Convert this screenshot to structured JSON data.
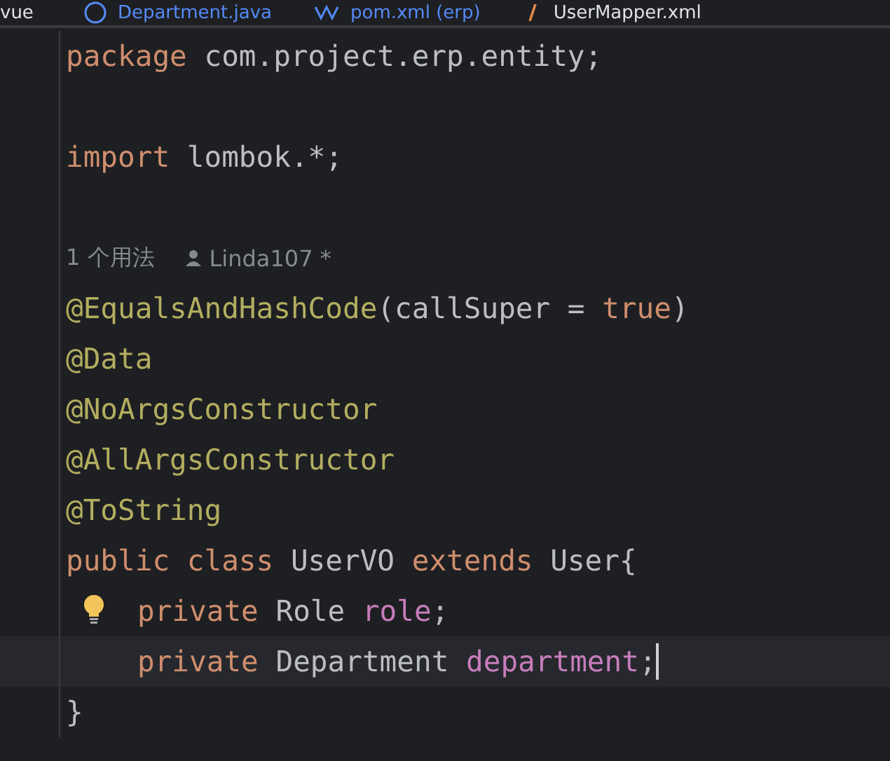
{
  "tabs": [
    {
      "label": "vue",
      "kind": "plain",
      "modified": false
    },
    {
      "label": "Department.java",
      "kind": "class",
      "modified": true
    },
    {
      "label": "pom.xml (erp)",
      "kind": "maven",
      "modified": true
    },
    {
      "label": "UserMapper.xml",
      "kind": "xml",
      "modified": false
    }
  ],
  "lines": [
    {
      "kind": "code",
      "indent": false,
      "current": false,
      "bulb": false,
      "tokens": [
        {
          "text": "package",
          "kind": "keyword"
        },
        {
          "text": " com.project.erp.entity;",
          "kind": "plain"
        }
      ]
    },
    {
      "kind": "blank"
    },
    {
      "kind": "code",
      "indent": false,
      "current": false,
      "bulb": false,
      "tokens": [
        {
          "text": "import",
          "kind": "keyword"
        },
        {
          "text": " lombok.*;",
          "kind": "plain"
        }
      ]
    },
    {
      "kind": "blank"
    },
    {
      "kind": "hint",
      "usages": "1 个用法",
      "author": "Linda107 *"
    },
    {
      "kind": "code",
      "indent": false,
      "current": false,
      "bulb": false,
      "tokens": [
        {
          "text": "@EqualsAndHashCode",
          "kind": "annotation"
        },
        {
          "text": "(callSuper = ",
          "kind": "plain"
        },
        {
          "text": "true",
          "kind": "keyword"
        },
        {
          "text": ")",
          "kind": "plain"
        }
      ]
    },
    {
      "kind": "code",
      "indent": false,
      "current": false,
      "bulb": false,
      "tokens": [
        {
          "text": "@Data",
          "kind": "annotation"
        }
      ]
    },
    {
      "kind": "code",
      "indent": false,
      "current": false,
      "bulb": false,
      "tokens": [
        {
          "text": "@NoArgsConstructor",
          "kind": "annotation"
        }
      ]
    },
    {
      "kind": "code",
      "indent": false,
      "current": false,
      "bulb": false,
      "tokens": [
        {
          "text": "@AllArgsConstructor",
          "kind": "annotation"
        }
      ]
    },
    {
      "kind": "code",
      "indent": false,
      "current": false,
      "bulb": false,
      "tokens": [
        {
          "text": "@ToString",
          "kind": "annotation"
        }
      ]
    },
    {
      "kind": "code",
      "indent": false,
      "current": false,
      "bulb": false,
      "tokens": [
        {
          "text": "public class",
          "kind": "keyword"
        },
        {
          "text": " UserVO ",
          "kind": "plain"
        },
        {
          "text": "extends",
          "kind": "keyword"
        },
        {
          "text": " User{",
          "kind": "plain"
        }
      ]
    },
    {
      "kind": "code",
      "indent": true,
      "current": false,
      "bulb": true,
      "tokens": [
        {
          "text": "private",
          "kind": "keyword"
        },
        {
          "text": " Role ",
          "kind": "plain"
        },
        {
          "text": "role",
          "kind": "field"
        },
        {
          "text": ";",
          "kind": "plain"
        }
      ]
    },
    {
      "kind": "code",
      "indent": true,
      "current": true,
      "bulb": false,
      "tokens": [
        {
          "text": "private",
          "kind": "keyword"
        },
        {
          "text": " Department ",
          "kind": "plain"
        },
        {
          "text": "department",
          "kind": "field"
        },
        {
          "text": ";",
          "kind": "plain"
        }
      ]
    },
    {
      "kind": "code",
      "indent": false,
      "current": false,
      "bulb": false,
      "tokens": [
        {
          "text": "}",
          "kind": "plain"
        }
      ]
    }
  ]
}
